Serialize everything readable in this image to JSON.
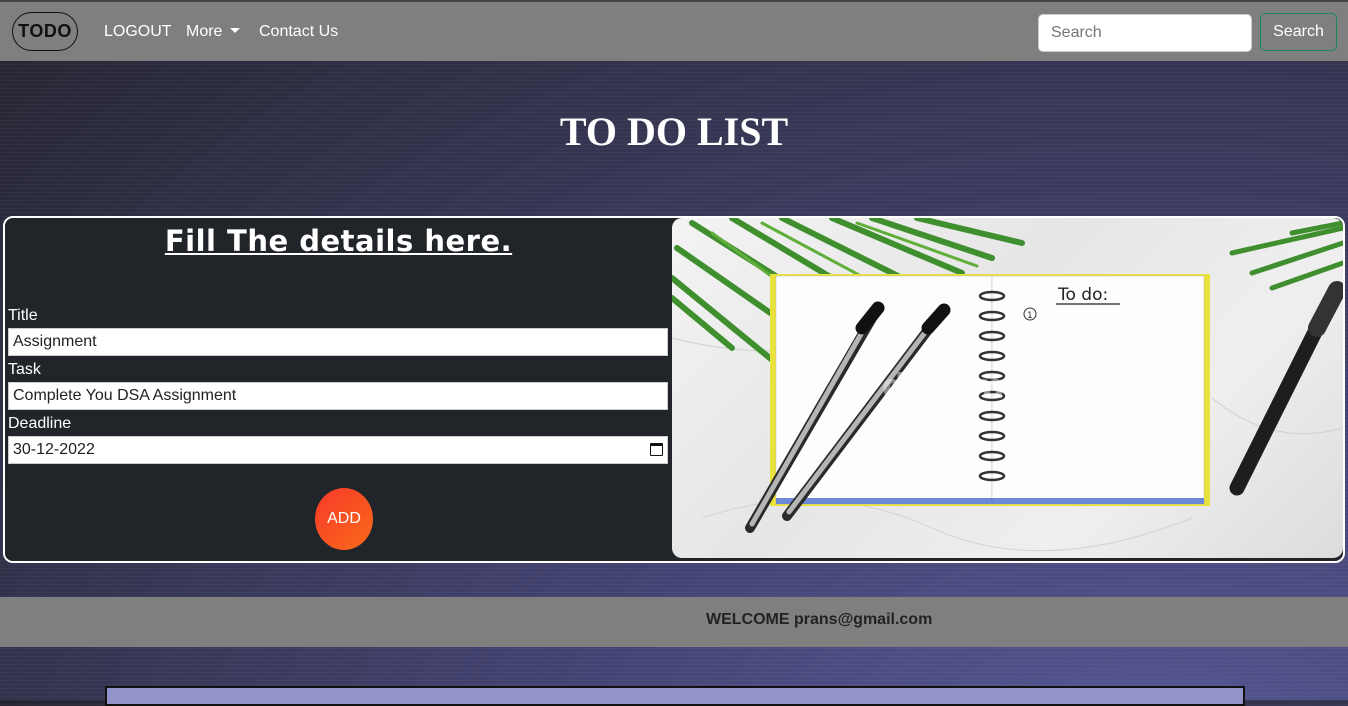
{
  "navbar": {
    "brand": "TODO",
    "links": {
      "logout": "LOGOUT",
      "more": "More",
      "contact": "Contact Us"
    },
    "search": {
      "placeholder": "Search",
      "button_label": "Search"
    }
  },
  "page_title": "TO DO LIST",
  "form": {
    "heading": "Fill The details here.",
    "title_label": "Title",
    "title_value": "Assignment",
    "task_label": "Task",
    "task_value": "Complete You DSA Assignment",
    "deadline_label": "Deadline",
    "deadline_value": "30-12-2022",
    "add_button": "ADD"
  },
  "illustration": {
    "notebook_text": "To do:",
    "item_marker": "1",
    "watermark": "dreamstime."
  },
  "welcome": {
    "text": "WELCOME prans@gmail.com"
  },
  "colors": {
    "navbar": "#7f7f7f",
    "form_bg": "#212529",
    "add_button": "#f7392a",
    "search_button_border": "#198754"
  }
}
